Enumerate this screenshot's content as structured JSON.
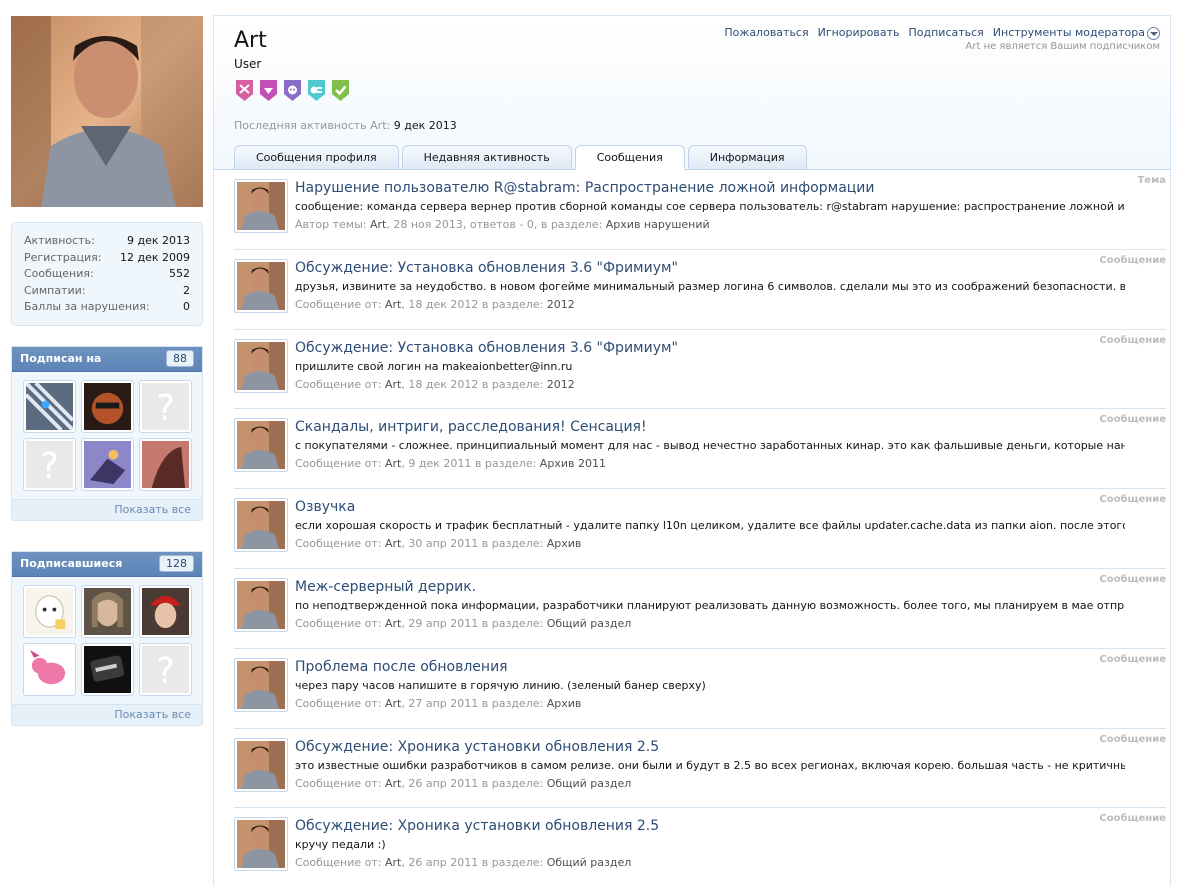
{
  "sidebar": {
    "stats": [
      {
        "label": "Активность:",
        "value": "9 дек 2013"
      },
      {
        "label": "Регистрация:",
        "value": "12 дек 2009"
      },
      {
        "label": "Сообщения:",
        "value": "552"
      },
      {
        "label": "Симпатии:",
        "value": "2"
      },
      {
        "label": "Баллы за нарушения:",
        "value": "0"
      }
    ],
    "following": {
      "title": "Подписан на",
      "count": "88",
      "show_all": "Показать все"
    },
    "followers": {
      "title": "Подписавшиеся",
      "count": "128",
      "show_all": "Показать все"
    }
  },
  "header": {
    "username": "Art",
    "user_title": "User",
    "last_activity_label": "Последняя активность Art:",
    "last_activity_value": "9 дек 2013",
    "actions": {
      "report": "Пожаловаться",
      "ignore": "Игнорировать",
      "follow": "Подписаться",
      "mod_tools": "Инструменты модератора"
    },
    "follow_note": "Art не является Вашим подписчиком",
    "badge_colors": [
      "#d65fa2",
      "#c24fb6",
      "#8a6cc7",
      "#4fc9d0",
      "#7fc04a"
    ]
  },
  "tabs": [
    {
      "label": "Сообщения профиля"
    },
    {
      "label": "Недавняя активность"
    },
    {
      "label": "Сообщения"
    },
    {
      "label": "Информация"
    }
  ],
  "items": [
    {
      "title": "Нарушение пользователю R@stabram: Распространение ложной информации",
      "snippet": "сообщение: команда сервера вернер против сборной команды сое сервера пользователь: r@stabram нарушение: распространение ложной информации...",
      "meta_prefix": "Автор темы: ",
      "author": "Art",
      "meta_mid": ", 28 ноя 2013, ответов - 0, в разделе: ",
      "section": "Архив нарушений",
      "type": "Тема"
    },
    {
      "title": "Обсуждение: Установка обновления 3.6 \"Фримиум\"",
      "snippet": "друзья, извините за неудобство. в новом фогейме минимальный размер логина 6 символов. сделали мы это из соображений безопасности. вы можете...",
      "meta_prefix": "Сообщение от: ",
      "author": "Art",
      "meta_mid": ", 18 дек 2012 в разделе: ",
      "section": "2012",
      "type": "Сообщение"
    },
    {
      "title": "Обсуждение: Установка обновления 3.6 \"Фримиум\"",
      "snippet": "пришлите свой логин на makeaionbetter@inn.ru",
      "meta_prefix": "Сообщение от: ",
      "author": "Art",
      "meta_mid": ", 18 дек 2012 в разделе: ",
      "section": "2012",
      "type": "Сообщение"
    },
    {
      "title": "Скандалы, интриги, расследования! Сенсация!",
      "snippet": "с покупателями - сложнее. принципиальный момент для нас - вывод нечестно заработанных кинар. это как фальшивые деньги, которые наносят ущерб...",
      "meta_prefix": "Сообщение от: ",
      "author": "Art",
      "meta_mid": ", 9 дек 2011 в разделе: ",
      "section": "Архив 2011",
      "type": "Сообщение"
    },
    {
      "title": "Озвучка",
      "snippet": "если хорошая скорость и трафик бесплатный - удалите папку l10n целиком, удалите все файлы updater.cache.data из папки aion. после этого сделайте...",
      "meta_prefix": "Сообщение от: ",
      "author": "Art",
      "meta_mid": ", 30 апр 2011 в разделе: ",
      "section": "Архив",
      "type": "Сообщение"
    },
    {
      "title": "Меж-серверный деррик.",
      "snippet": "по неподтвержденной пока информации, разработчики планируют реализовать данную возможность. более того, мы планируем в мае отправить им новую...",
      "meta_prefix": "Сообщение от: ",
      "author": "Art",
      "meta_mid": ", 29 апр 2011 в разделе: ",
      "section": "Общий раздел",
      "type": "Сообщение"
    },
    {
      "title": "Проблема после обновления",
      "snippet": "через пару часов напишите в горячую линию. (зеленый банер сверху)",
      "meta_prefix": "Сообщение от: ",
      "author": "Art",
      "meta_mid": ", 27 апр 2011 в разделе: ",
      "section": "Архив",
      "type": "Сообщение"
    },
    {
      "title": "Обсуждение: Хроника установки обновления 2.5",
      "snippet": "это известные ошибки разработчиков в самом релизе. они были и будут в 2.5 во всех регионах, включая корею. большая часть - не критичные, поэтому и...",
      "meta_prefix": "Сообщение от: ",
      "author": "Art",
      "meta_mid": ", 26 апр 2011 в разделе: ",
      "section": "Общий раздел",
      "type": "Сообщение"
    },
    {
      "title": "Обсуждение: Хроника установки обновления 2.5",
      "snippet": "кручу педали :)",
      "meta_prefix": "Сообщение от: ",
      "author": "Art",
      "meta_mid": ", 26 апр 2011 в разделе: ",
      "section": "Общий раздел",
      "type": "Сообщение"
    }
  ]
}
